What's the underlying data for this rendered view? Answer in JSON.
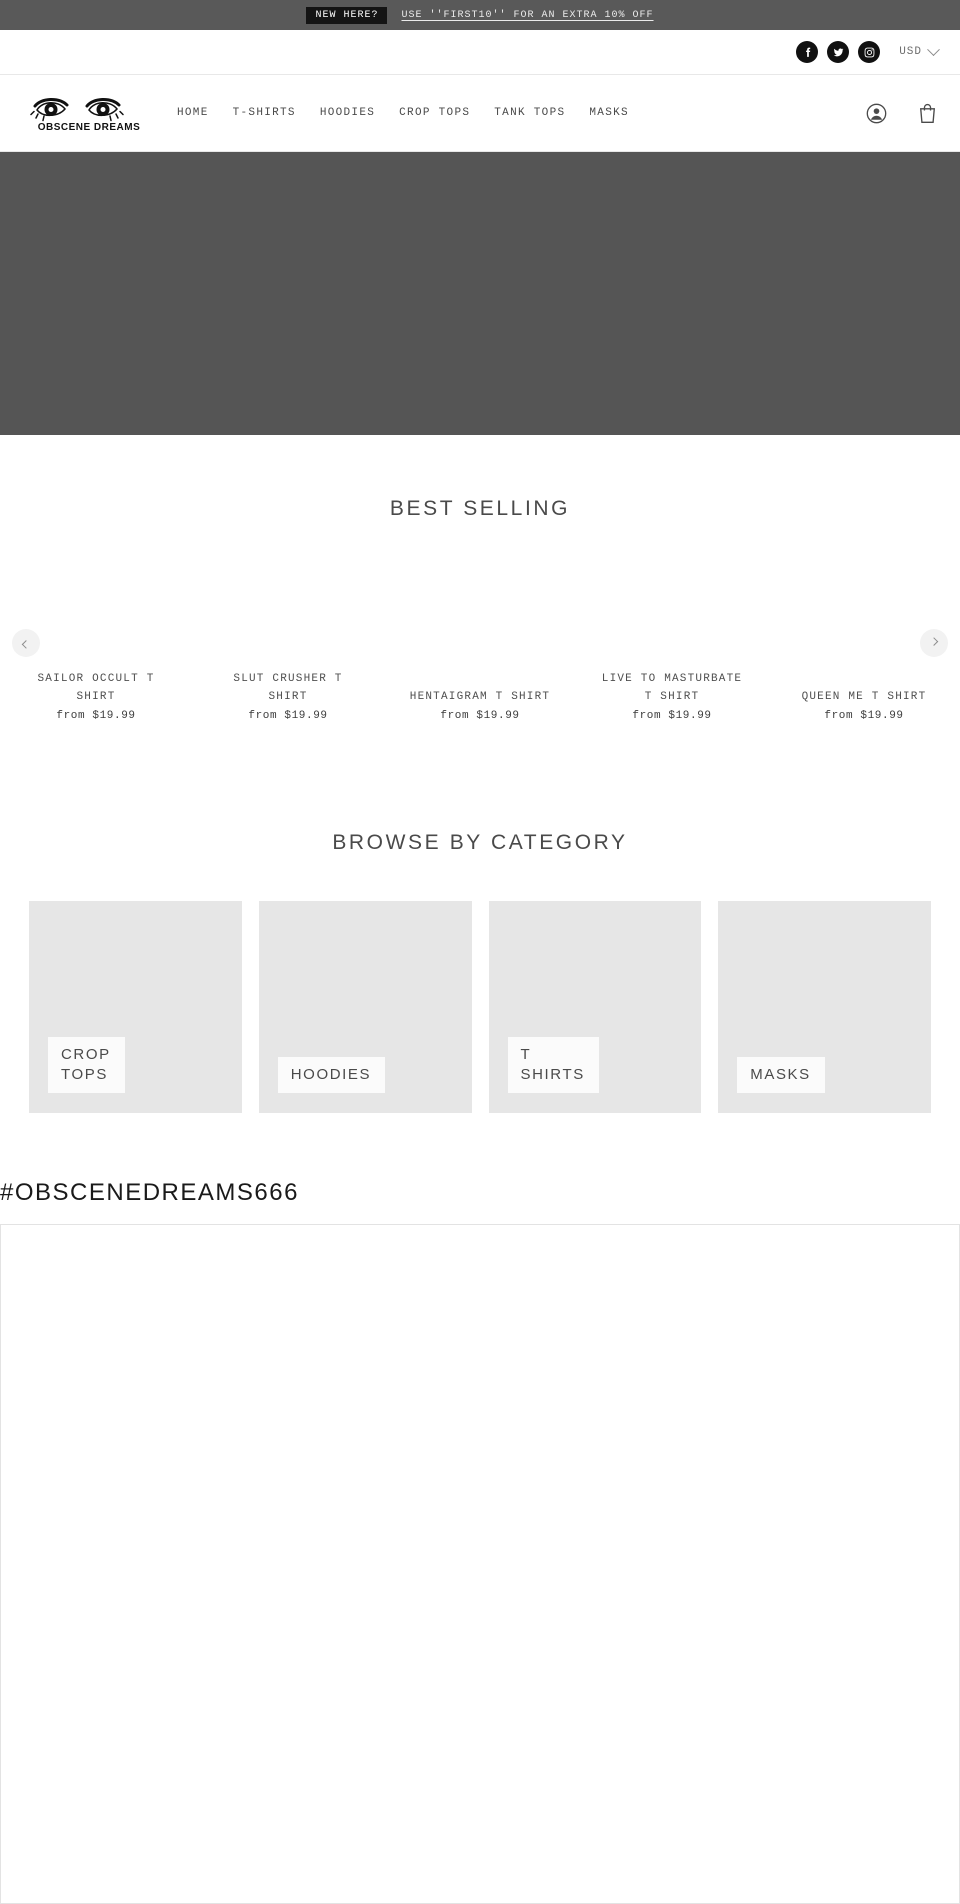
{
  "announcement": {
    "badge": "NEW HERE?",
    "text": "USE ''FIRST10'' FOR AN EXTRA 10% OFF"
  },
  "utility_bar": {
    "social": [
      {
        "name": "facebook-icon",
        "label": "Facebook"
      },
      {
        "name": "twitter-icon",
        "label": "Twitter"
      },
      {
        "name": "instagram-icon",
        "label": "Instagram"
      }
    ],
    "currency": {
      "selected": "USD",
      "icon": "chevron-down-icon"
    }
  },
  "header": {
    "logo": {
      "text": "OBSCENE DREAMS",
      "icon": "eyes-logo-icon"
    },
    "nav": [
      {
        "label": "HOME"
      },
      {
        "label": "T-SHIRTS"
      },
      {
        "label": "HOODIES"
      },
      {
        "label": "CROP TOPS"
      },
      {
        "label": "TANK TOPS"
      },
      {
        "label": "MASKS"
      }
    ],
    "actions": [
      {
        "name": "account-icon",
        "label": "Account"
      },
      {
        "name": "cart-icon",
        "label": "Cart"
      }
    ]
  },
  "hero": {
    "background_color": "#555555"
  },
  "best_selling": {
    "title": "BEST SELLING",
    "prev_label": "Previous",
    "next_label": "Next",
    "products": [
      {
        "title": "SAILOR OCCULT T SHIRT",
        "price": "from $19.99"
      },
      {
        "title": "SLUT CRUSHER T SHIRT",
        "price": "from $19.99"
      },
      {
        "title": "HENTAIGRAM T SHIRT",
        "price": "from $19.99"
      },
      {
        "title": "LIVE TO MASTURBATE T SHIRT",
        "price": "from $19.99"
      },
      {
        "title": "QUEEN ME T SHIRT",
        "price": "from $19.99"
      }
    ]
  },
  "browse_by_category": {
    "title": "BROWSE BY CATEGORY",
    "categories": [
      {
        "label": "CROP\nTOPS"
      },
      {
        "label": "HOODIES"
      },
      {
        "label": "T\nSHIRTS"
      },
      {
        "label": "MASKS"
      }
    ]
  },
  "instagram_section": {
    "hashtag": "#OBSCENEDREAMS666"
  }
}
